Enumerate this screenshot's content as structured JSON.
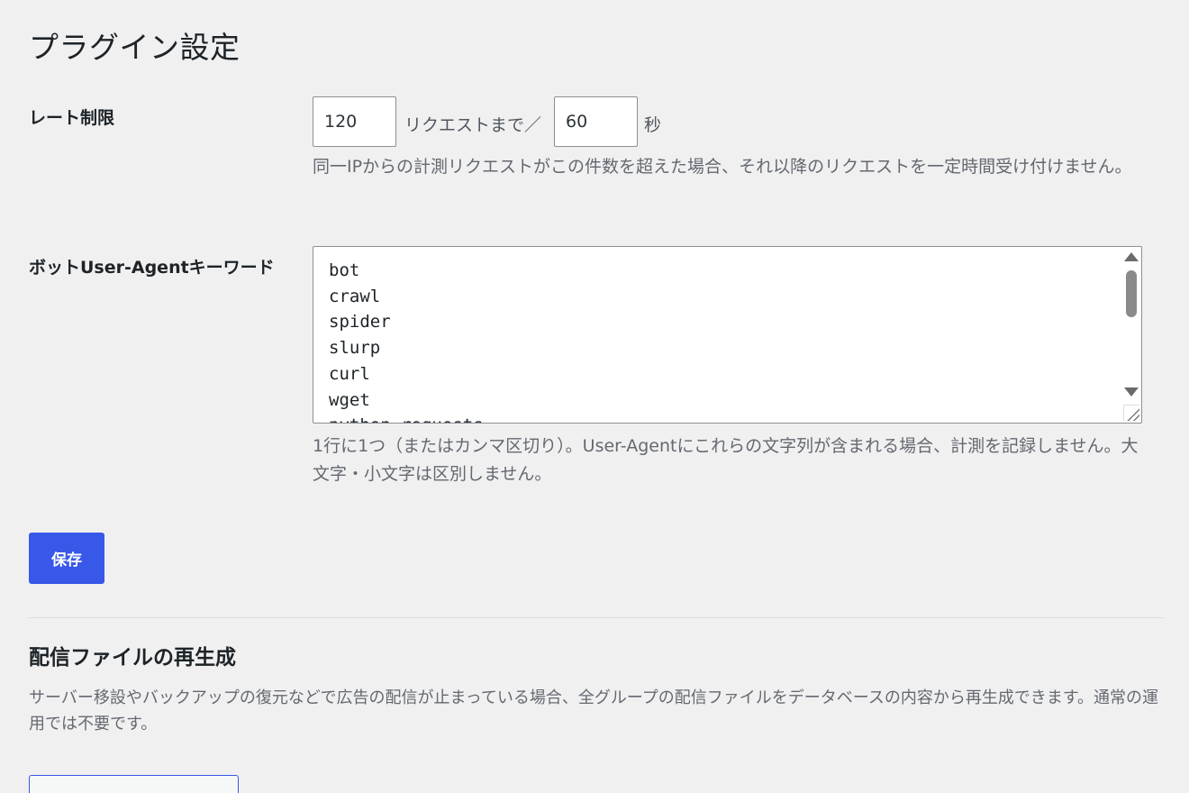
{
  "page": {
    "title": "プラグイン設定"
  },
  "rate_limit": {
    "label": "レート制限",
    "requests_value": "120",
    "between_text": "リクエストまで／",
    "seconds_value": "60",
    "unit_text": "秒",
    "description": "同一IPからの計測リクエストがこの件数を超えた場合、それ以降のリクエストを一定時間受け付けません。"
  },
  "bot_keywords": {
    "label": "ボットUser-Agentキーワード",
    "lines": [
      "bot",
      "crawl",
      "spider",
      "slurp",
      "curl",
      "wget",
      "python-requests"
    ],
    "description": "1行に1つ（またはカンマ区切り）。User-Agentにこれらの文字列が含まれる場合、計測を記録しません。大文字・小文字は区別しません。"
  },
  "save_button": {
    "label": "保存"
  },
  "regenerate": {
    "title": "配信ファイルの再生成",
    "description": "サーバー移設やバックアップの復元などで広告の配信が止まっている場合、全グループの配信ファイルをデータベースの内容から再生成できます。通常の運用では不要です。",
    "button_label": ""
  },
  "colors": {
    "accent": "#3858e9",
    "background": "#f0f0f1",
    "text": "#1d2327",
    "muted_text": "#646970"
  }
}
